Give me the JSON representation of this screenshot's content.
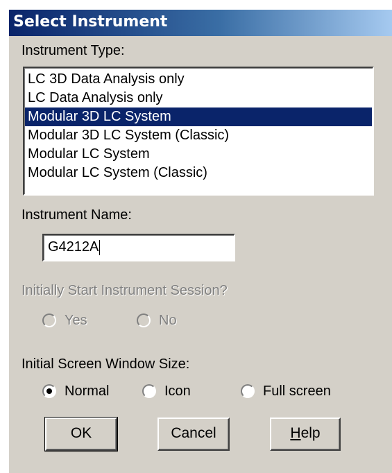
{
  "window": {
    "title": "Select Instrument"
  },
  "instrument_type": {
    "label": "Instrument Type:",
    "items": [
      {
        "label": "LC 3D Data Analysis only",
        "selected": false
      },
      {
        "label": "LC Data Analysis only",
        "selected": false
      },
      {
        "label": "Modular 3D LC System",
        "selected": true
      },
      {
        "label": "Modular 3D LC System (Classic)",
        "selected": false
      },
      {
        "label": "Modular LC System",
        "selected": false
      },
      {
        "label": "Modular LC System (Classic)",
        "selected": false
      }
    ]
  },
  "instrument_name": {
    "label": "Instrument Name:",
    "value": "G4212A"
  },
  "start_session": {
    "label": "Initially Start Instrument Session?",
    "enabled": false,
    "options": [
      {
        "label": "Yes",
        "checked": false
      },
      {
        "label": "No",
        "checked": false
      }
    ]
  },
  "window_size": {
    "label": "Initial Screen Window Size:",
    "options": [
      {
        "label": "Normal",
        "checked": true
      },
      {
        "label": "Icon",
        "checked": false
      },
      {
        "label": "Full screen",
        "checked": false
      }
    ]
  },
  "buttons": {
    "ok": "OK",
    "cancel": "Cancel",
    "help_prefix": "H",
    "help_rest": "elp"
  },
  "colors": {
    "dialog_face": "#d4d0c8",
    "selection": "#0a246a",
    "title_gradient_start": "#0a246a",
    "title_gradient_end": "#a6caf0"
  }
}
